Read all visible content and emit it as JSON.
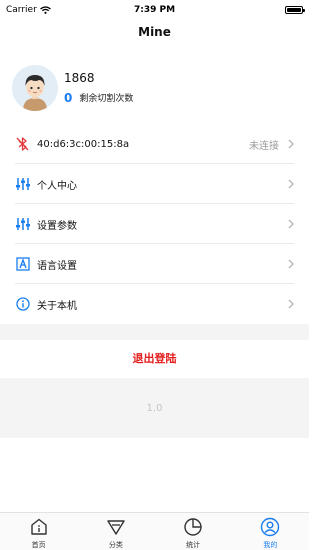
{
  "status_bar": {
    "carrier": "Carrier",
    "time": "7:39 PM",
    "battery_percent": 100
  },
  "nav": {
    "title": "Mine"
  },
  "profile": {
    "phone": "1868",
    "remain_count": "0",
    "remain_label": "剩余切割次数"
  },
  "list": {
    "device": {
      "label": "40:d6:3c:00:15:8a",
      "status": "未连接",
      "icon": "bluetooth-disabled-icon"
    },
    "personal": {
      "label": "个人中心",
      "icon": "sliders-icon"
    },
    "settings": {
      "label": "设置参数",
      "icon": "sliders-icon"
    },
    "language": {
      "label": "语言设置",
      "icon": "language-icon"
    },
    "about": {
      "label": "关于本机",
      "icon": "info-icon"
    }
  },
  "logout_label": "退出登陆",
  "version": "1.0",
  "tabbar": {
    "home": {
      "label": "首页",
      "icon": "home-icon"
    },
    "category": {
      "label": "分类",
      "icon": "category-icon"
    },
    "stats": {
      "label": "统计",
      "icon": "pie-chart-icon"
    },
    "mine": {
      "label": "我的",
      "icon": "user-icon"
    }
  },
  "colors": {
    "accent": "#1a7ef0",
    "danger": "#e41a1a",
    "muted": "#9a9a9a"
  }
}
